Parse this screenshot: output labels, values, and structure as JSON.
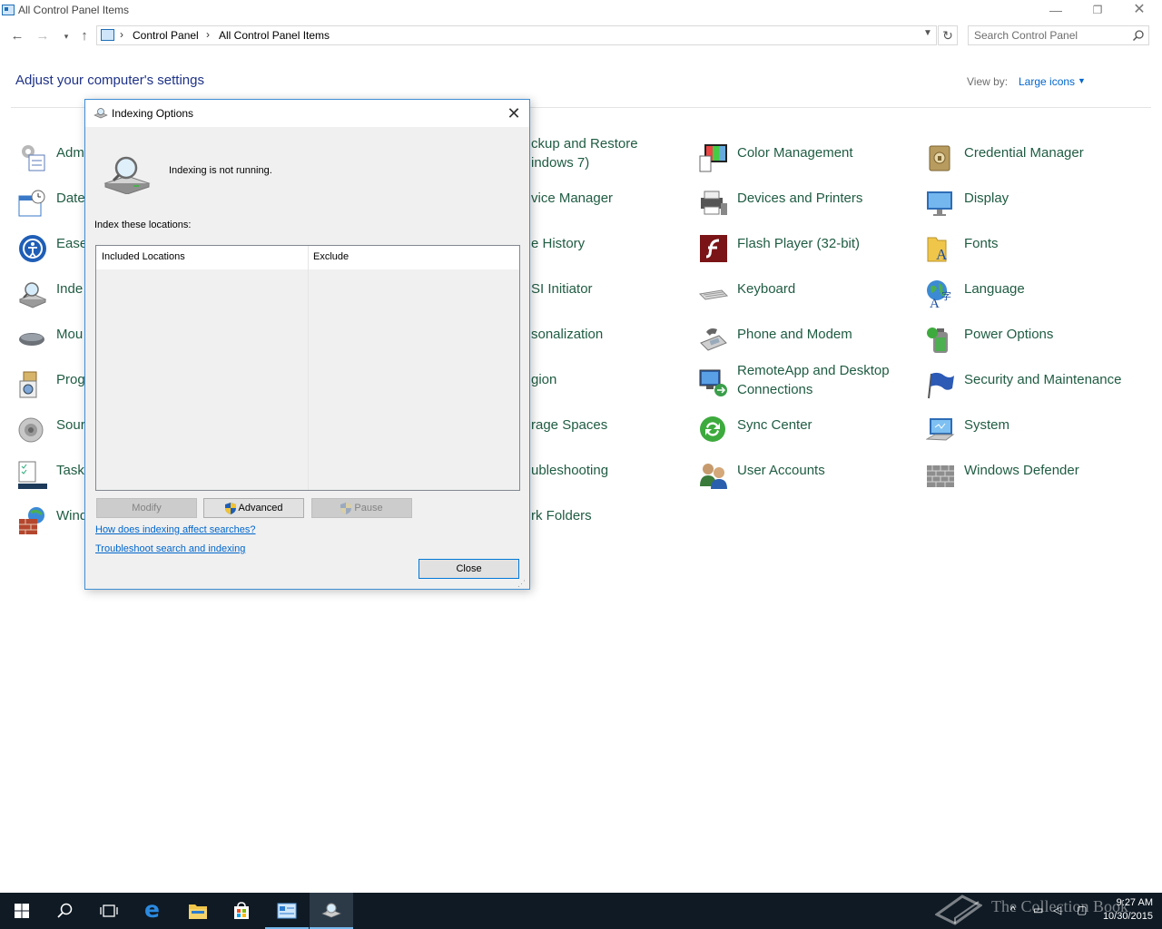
{
  "window": {
    "title": "All Control Panel Items",
    "minimize": "—",
    "maximize": "❐",
    "close": "✕"
  },
  "address": {
    "breadcrumb": [
      "Control Panel",
      "All Control Panel Items"
    ],
    "chevron": "›",
    "search_placeholder": "Search Control Panel"
  },
  "header": {
    "heading": "Adjust your computer's settings",
    "view_by_label": "View by:",
    "view_by_value": "Large icons"
  },
  "items": [
    {
      "label": "Adm",
      "icon": "admin-tools-icon"
    },
    {
      "label": "Date",
      "icon": "date-time-icon"
    },
    {
      "label": "Ease",
      "icon": "ease-of-access-icon"
    },
    {
      "label": "Inde",
      "icon": "indexing-icon"
    },
    {
      "label": "Mou",
      "icon": "mouse-icon"
    },
    {
      "label": "Prog",
      "icon": "programs-icon"
    },
    {
      "label": "Sour",
      "icon": "sound-icon"
    },
    {
      "label": "Task",
      "icon": "taskbar-icon"
    },
    {
      "label": "Wind",
      "icon": "firewall-icon"
    },
    {
      "label": "ckup and Restore\nindows 7)",
      "icon": "backup-icon"
    },
    {
      "label": "vice Manager",
      "icon": "device-manager-icon"
    },
    {
      "label": "e History",
      "icon": "file-history-icon"
    },
    {
      "label": "SI Initiator",
      "icon": "iscsi-icon"
    },
    {
      "label": "sonalization",
      "icon": "personalization-icon"
    },
    {
      "label": "gion",
      "icon": "region-icon"
    },
    {
      "label": "rage Spaces",
      "icon": "storage-spaces-icon"
    },
    {
      "label": "ubleshooting",
      "icon": "troubleshooting-icon"
    },
    {
      "label": "rk Folders",
      "icon": "work-folders-icon"
    },
    {
      "label": "Color Management",
      "icon": "color-management-icon"
    },
    {
      "label": "Devices and Printers",
      "icon": "devices-printers-icon"
    },
    {
      "label": "Flash Player (32-bit)",
      "icon": "flash-player-icon"
    },
    {
      "label": "Keyboard",
      "icon": "keyboard-icon"
    },
    {
      "label": "Phone and Modem",
      "icon": "phone-modem-icon"
    },
    {
      "label": "RemoteApp and Desktop Connections",
      "icon": "remoteapp-icon"
    },
    {
      "label": "Sync Center",
      "icon": "sync-center-icon"
    },
    {
      "label": "User Accounts",
      "icon": "user-accounts-icon"
    },
    {
      "label": "Credential Manager",
      "icon": "credential-manager-icon"
    },
    {
      "label": "Display",
      "icon": "display-icon"
    },
    {
      "label": "Fonts",
      "icon": "fonts-icon"
    },
    {
      "label": "Language",
      "icon": "language-icon"
    },
    {
      "label": "Power Options",
      "icon": "power-options-icon"
    },
    {
      "label": "Security and Maintenance",
      "icon": "security-maintenance-icon"
    },
    {
      "label": "System",
      "icon": "system-icon"
    },
    {
      "label": "Windows Defender",
      "icon": "windows-defender-icon"
    }
  ],
  "dialog": {
    "title": "Indexing Options",
    "close": "✕",
    "status": "Indexing is not running.",
    "index_label": "Index these locations:",
    "columns": [
      "Included Locations",
      "Exclude"
    ],
    "buttons": {
      "modify": "Modify",
      "advanced": "Advanced",
      "pause": "Pause",
      "close": "Close"
    },
    "links": {
      "how": "How does indexing affect searches?",
      "troubleshoot": "Troubleshoot search and indexing"
    }
  },
  "taskbar": {
    "time": "9:27 AM",
    "date": "10/30/2015",
    "watermark": "The Collection Book"
  },
  "colors": {
    "link": "#0066cc",
    "item_text": "#1f5c42",
    "heading": "#1e3287",
    "taskbar": "#0f1a24",
    "accent": "#0078d7"
  }
}
